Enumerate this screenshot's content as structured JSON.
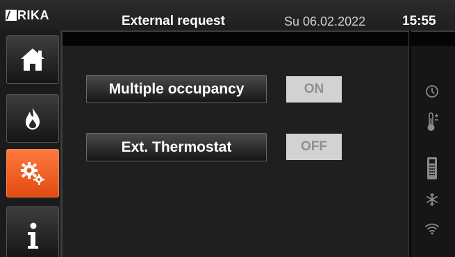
{
  "header": {
    "brand": "RIKA",
    "title": "External request",
    "date": "Su 06.02.2022",
    "time": "15:55"
  },
  "nav": [
    {
      "name": "home",
      "icon": "home-icon",
      "active": false
    },
    {
      "name": "flame",
      "icon": "flame-icon",
      "active": false
    },
    {
      "name": "settings",
      "icon": "gears-icon",
      "active": true
    },
    {
      "name": "info",
      "icon": "info-icon",
      "active": false
    }
  ],
  "settings": [
    {
      "label": "Multiple occupancy",
      "state": "ON"
    },
    {
      "label": "Ext. Thermostat",
      "state": "OFF"
    }
  ],
  "status_icons": [
    "clock-icon",
    "thermometer-icon",
    "remote-icon",
    "snowflake-icon",
    "wifi-icon"
  ],
  "colors": {
    "accent": "#f05a1e",
    "background": "#1f1f1f",
    "text": "#ffffff"
  }
}
